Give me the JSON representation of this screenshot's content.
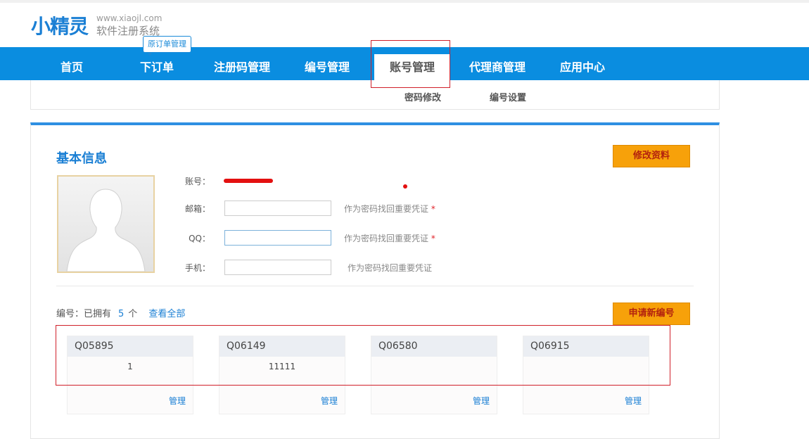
{
  "logo": {
    "main": "小精灵",
    "url": "www.xiaojl.com",
    "subtitle": "软件注册系统"
  },
  "nav": {
    "items": [
      {
        "label": "首页"
      },
      {
        "label": "下订单"
      },
      {
        "label": "注册码管理"
      },
      {
        "label": "编号管理"
      },
      {
        "label": "账号管理"
      },
      {
        "label": "代理商管理"
      },
      {
        "label": "应用中心"
      }
    ],
    "active": "账号管理",
    "tooltip": "原订单管理"
  },
  "subnav": {
    "items": [
      {
        "label": "密码修改"
      },
      {
        "label": "编号设置"
      }
    ]
  },
  "basic_info": {
    "title": "基本信息",
    "edit_button": "修改资料",
    "account_label": "账号：",
    "email_label": "邮箱：",
    "email_value": "",
    "email_hint": "作为密码找回重要凭证",
    "qq_label": "QQ：",
    "qq_value": "",
    "qq_hint": "作为密码找回重要凭证",
    "phone_label": "手机：",
    "phone_value": "",
    "phone_hint": "作为密码找回重要凭证",
    "required_mark": "*"
  },
  "numbers": {
    "prefix": "编号：已拥有",
    "count": "5",
    "unit": "个",
    "view_all": "查看全部",
    "apply_button": "申请新编号",
    "cards": [
      {
        "code": "Q05895",
        "value": "1",
        "manage": "管理"
      },
      {
        "code": "Q06149",
        "value": "11111",
        "manage": "管理"
      },
      {
        "code": "Q06580",
        "value": "",
        "manage": "管理"
      },
      {
        "code": "Q06915",
        "value": "",
        "manage": "管理"
      }
    ]
  },
  "colors": {
    "brand": "#0a8de0",
    "accent_button": "#f7a10a",
    "link": "#1a7fd4",
    "annotation": "#d0202a"
  }
}
